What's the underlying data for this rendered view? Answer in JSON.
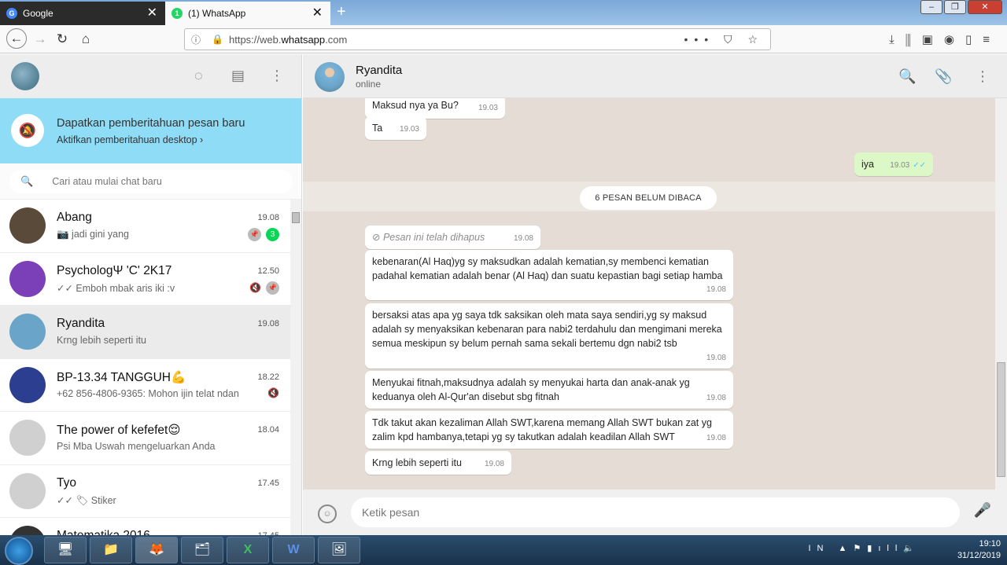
{
  "browser": {
    "tabs": [
      {
        "label": "Google",
        "icon": "google-icon",
        "active": false
      },
      {
        "label": "(1) WhatsApp",
        "icon": "whatsapp-icon",
        "active": true
      }
    ],
    "url_prefix": "https://web.",
    "url_domain": "whatsapp.com",
    "url_suffix": ".com"
  },
  "sidebar": {
    "notification": {
      "title": "Dapatkan pemberitahuan pesan baru",
      "subtitle": "Aktifkan pemberitahuan desktop ›"
    },
    "search_placeholder": "Cari atau mulai chat baru",
    "chats": [
      {
        "name": "Abang",
        "time": "19.08",
        "last": "📷 jadi gini yang",
        "pinned": true,
        "unread": "3",
        "muted": false,
        "avatar_color": "#5a4a3a"
      },
      {
        "name": "PsychologΨ 'C' 2K17",
        "time": "12.50",
        "last": "✓✓ Emboh mbak aris iki :v",
        "pinned": true,
        "unread": "",
        "muted": true,
        "avatar_color": "#7b3fb8"
      },
      {
        "name": "Ryandita",
        "time": "19.08",
        "last": "Krng lebih seperti itu",
        "pinned": false,
        "unread": "",
        "muted": false,
        "avatar_color": "#6aa4c9"
      },
      {
        "name": "BP-13.34 TANGGUH💪",
        "time": "18.22",
        "last": "+62 856-4806-9365: Mohon ijin telat ndan",
        "pinned": false,
        "unread": "",
        "muted": true,
        "avatar_color": "#2c3e8f"
      },
      {
        "name": "The power of kefefet😌",
        "time": "18.04",
        "last": "Psi Mba Uswah mengeluarkan Anda",
        "pinned": false,
        "unread": "",
        "muted": false,
        "avatar_color": "#d0d0d0"
      },
      {
        "name": "Tyo",
        "time": "17.45",
        "last": "✓✓ 🏷 Stiker",
        "pinned": false,
        "unread": "",
        "muted": false,
        "avatar_color": "#d0d0d0"
      },
      {
        "name": "Matematika 2016",
        "time": "17.45",
        "last": "",
        "pinned": false,
        "unread": "",
        "muted": false,
        "avatar_color": "#333333"
      }
    ]
  },
  "conversation": {
    "contact_name": "Ryandita",
    "contact_status": "online",
    "unread_divider": "6 PESAN BELUM DIBACA",
    "messages": [
      {
        "text": "Maksud nya ya Bu?",
        "time": "19.03",
        "dir": "in"
      },
      {
        "text": "Ta",
        "time": "19.03",
        "dir": "in"
      },
      {
        "text": "iya",
        "time": "19.03",
        "dir": "out"
      },
      {
        "text": "Pesan ini telah dihapus",
        "time": "19.08",
        "dir": "in"
      },
      {
        "text": "kebenaran(Al Haq)yg sy maksudkan adalah kematian,sy membenci kematian padahal kematian adalah benar (Al Haq) dan suatu kepastian bagi setiap hamba",
        "time": "19.08",
        "dir": "in"
      },
      {
        "text": "bersaksi atas apa yg saya tdk saksikan oleh mata saya sendiri,yg sy maksud adalah sy menyaksikan kebenaran para nabi2 terdahulu dan mengimani mereka semua meskipun sy belum pernah sama sekali bertemu dgn nabi2 tsb",
        "time": "19.08",
        "dir": "in"
      },
      {
        "text": "Menyukai fitnah,maksudnya adalah sy menyukai harta dan anak-anak yg keduanya oleh Al-Qur'an disebut sbg fitnah",
        "time": "19.08",
        "dir": "in"
      },
      {
        "text": "Tdk takut akan kezaliman Allah SWT,karena memang Allah SWT bukan zat yg zalim kpd hambanya,tetapi yg sy takutkan adalah keadilan Allah SWT",
        "time": "19.08",
        "dir": "in"
      },
      {
        "text": "Krng lebih seperti itu",
        "time": "19.08",
        "dir": "in"
      }
    ],
    "input_placeholder": "Ketik pesan"
  },
  "taskbar": {
    "lang": "IN",
    "time": "19:10",
    "date": "31/12/2019"
  }
}
